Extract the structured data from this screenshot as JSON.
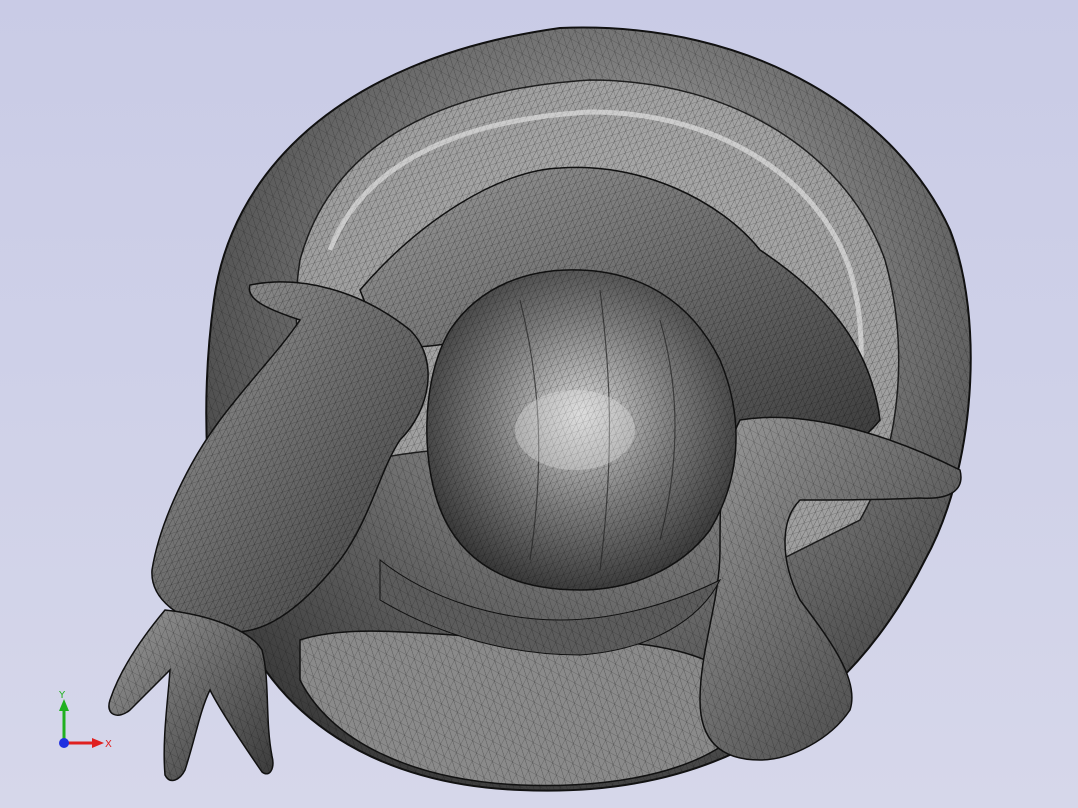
{
  "viewport": {
    "background_top": "#c9cbe6",
    "background_bottom": "#d6d7ea",
    "model": {
      "mesh_color": "#111111",
      "surface_color": "#6f6f6f",
      "highlight_color": "#d9d9d9"
    }
  },
  "triad": {
    "x_label": "X",
    "y_label": "Y",
    "x_color": "#e02020",
    "y_color": "#20b020",
    "z_color": "#2030e0"
  }
}
